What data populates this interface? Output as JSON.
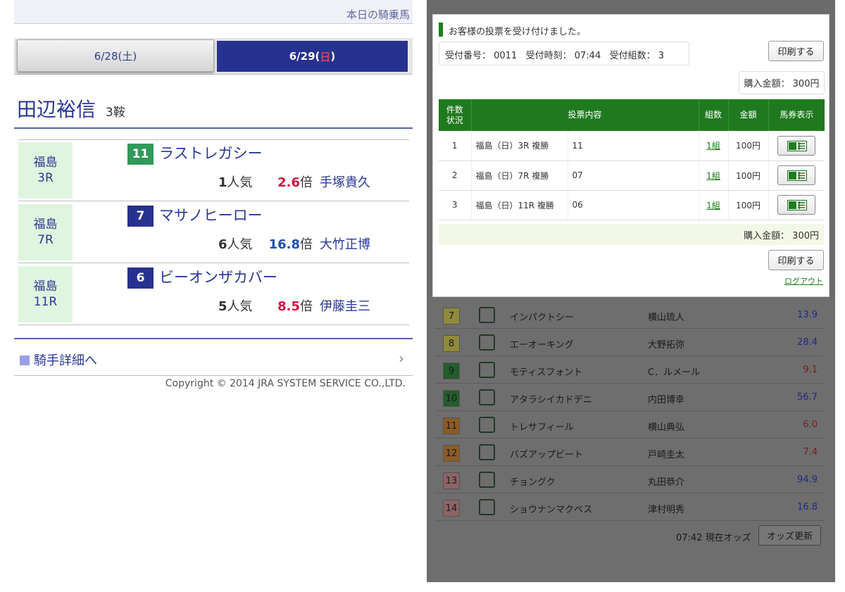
{
  "left": {
    "topbar": "本日の騎乗馬",
    "date_tabs": {
      "tab1": "6/28(土)",
      "tab2_prefix": "6/29(",
      "tab2_day": "日",
      "tab2_suffix": ")"
    },
    "jockey_name": "田辺裕信",
    "ride_count": "3鞍",
    "races": [
      {
        "venue": "福島",
        "race": "3R",
        "number": "11",
        "number_color": "#2f9a5a",
        "horse": "ラストレガシー",
        "pop_num": "1",
        "pop_label": "人気",
        "odds_num": "2.6",
        "odds_color": "#d0173f",
        "odds_label": "倍",
        "trainer": "手塚貴久"
      },
      {
        "venue": "福島",
        "race": "7R",
        "number": "7",
        "number_color": "#27318f",
        "horse": "マサノヒーロー",
        "pop_num": "6",
        "pop_label": "人気",
        "odds_num": "16.8",
        "odds_color": "#1f4fb0",
        "odds_label": "倍",
        "trainer": "大竹正博"
      },
      {
        "venue": "福島",
        "race": "11R",
        "number": "6",
        "number_color": "#27318f",
        "horse": "ビーオンザカバー",
        "pop_num": "5",
        "pop_label": "人気",
        "odds_num": "8.5",
        "odds_color": "#d0173f",
        "odds_label": "倍",
        "trainer": "伊藤圭三"
      }
    ],
    "detail_link": "騎手詳細へ",
    "copyright": "Copyright © 2014 JRA SYSTEM SERVICE CO.,LTD."
  },
  "right": {
    "dialog": {
      "message": "お客様の投票を受け付けました。",
      "receipt_info": "受付番号： 0011   受付時刻： 07:44   受付組数： 3",
      "print_label": "印刷する",
      "total_box": "購入金額： 300円",
      "table_headers": [
        "件数\n状況",
        "投票内容",
        "組数",
        "金額",
        "馬券表示"
      ],
      "rows": [
        {
          "no": "1",
          "content": "福島（日）3R 複勝",
          "horse": "11",
          "sets": "1組",
          "amount": "100円"
        },
        {
          "no": "2",
          "content": "福島（日）7R 複勝",
          "horse": "07",
          "sets": "1組",
          "amount": "100円"
        },
        {
          "no": "3",
          "content": "福島（日）11R 複勝",
          "horse": "06",
          "sets": "1組",
          "amount": "100円"
        }
      ],
      "sum_label": "購入金額： 300円",
      "logout": "ログアウト"
    },
    "odds_list": [
      {
        "frame": "7",
        "frame_color": "#8f8a3c",
        "horse": "インパクトシー",
        "jockey": "横山琉人",
        "odds": "13.9",
        "odds_color": "#1d2a86"
      },
      {
        "frame": "8",
        "frame_color": "#8f8a3c",
        "horse": "エーオーキング",
        "jockey": "大野拓弥",
        "odds": "28.4",
        "odds_color": "#1d2a86"
      },
      {
        "frame": "9",
        "frame_color": "#245c2c",
        "horse": "モティスフォント",
        "jockey": "C．ルメール",
        "odds": "9.1",
        "odds_color": "#7a1c1c"
      },
      {
        "frame": "10",
        "frame_color": "#245c2c",
        "horse": "アタラシイカドデニ",
        "jockey": "内田博幸",
        "odds": "56.7",
        "odds_color": "#1d2a86"
      },
      {
        "frame": "11",
        "frame_color": "#8a5c26",
        "horse": "トレサフィール",
        "jockey": "横山典弘",
        "odds": "6.0",
        "odds_color": "#7a1c1c"
      },
      {
        "frame": "12",
        "frame_color": "#8a5c26",
        "horse": "バズアップビート",
        "jockey": "戸崎圭太",
        "odds": "7.4",
        "odds_color": "#7a1c1c"
      },
      {
        "frame": "13",
        "frame_color": "#8c6466",
        "horse": "チョングク",
        "jockey": "丸田恭介",
        "odds": "94.9",
        "odds_color": "#1d2a86"
      },
      {
        "frame": "14",
        "frame_color": "#8c6466",
        "horse": "ショウナンマクベス",
        "jockey": "津村明秀",
        "odds": "16.8",
        "odds_color": "#1d2a86"
      }
    ],
    "odds_time": "07:42 現在オッズ",
    "odds_refresh": "オッズ更新"
  }
}
